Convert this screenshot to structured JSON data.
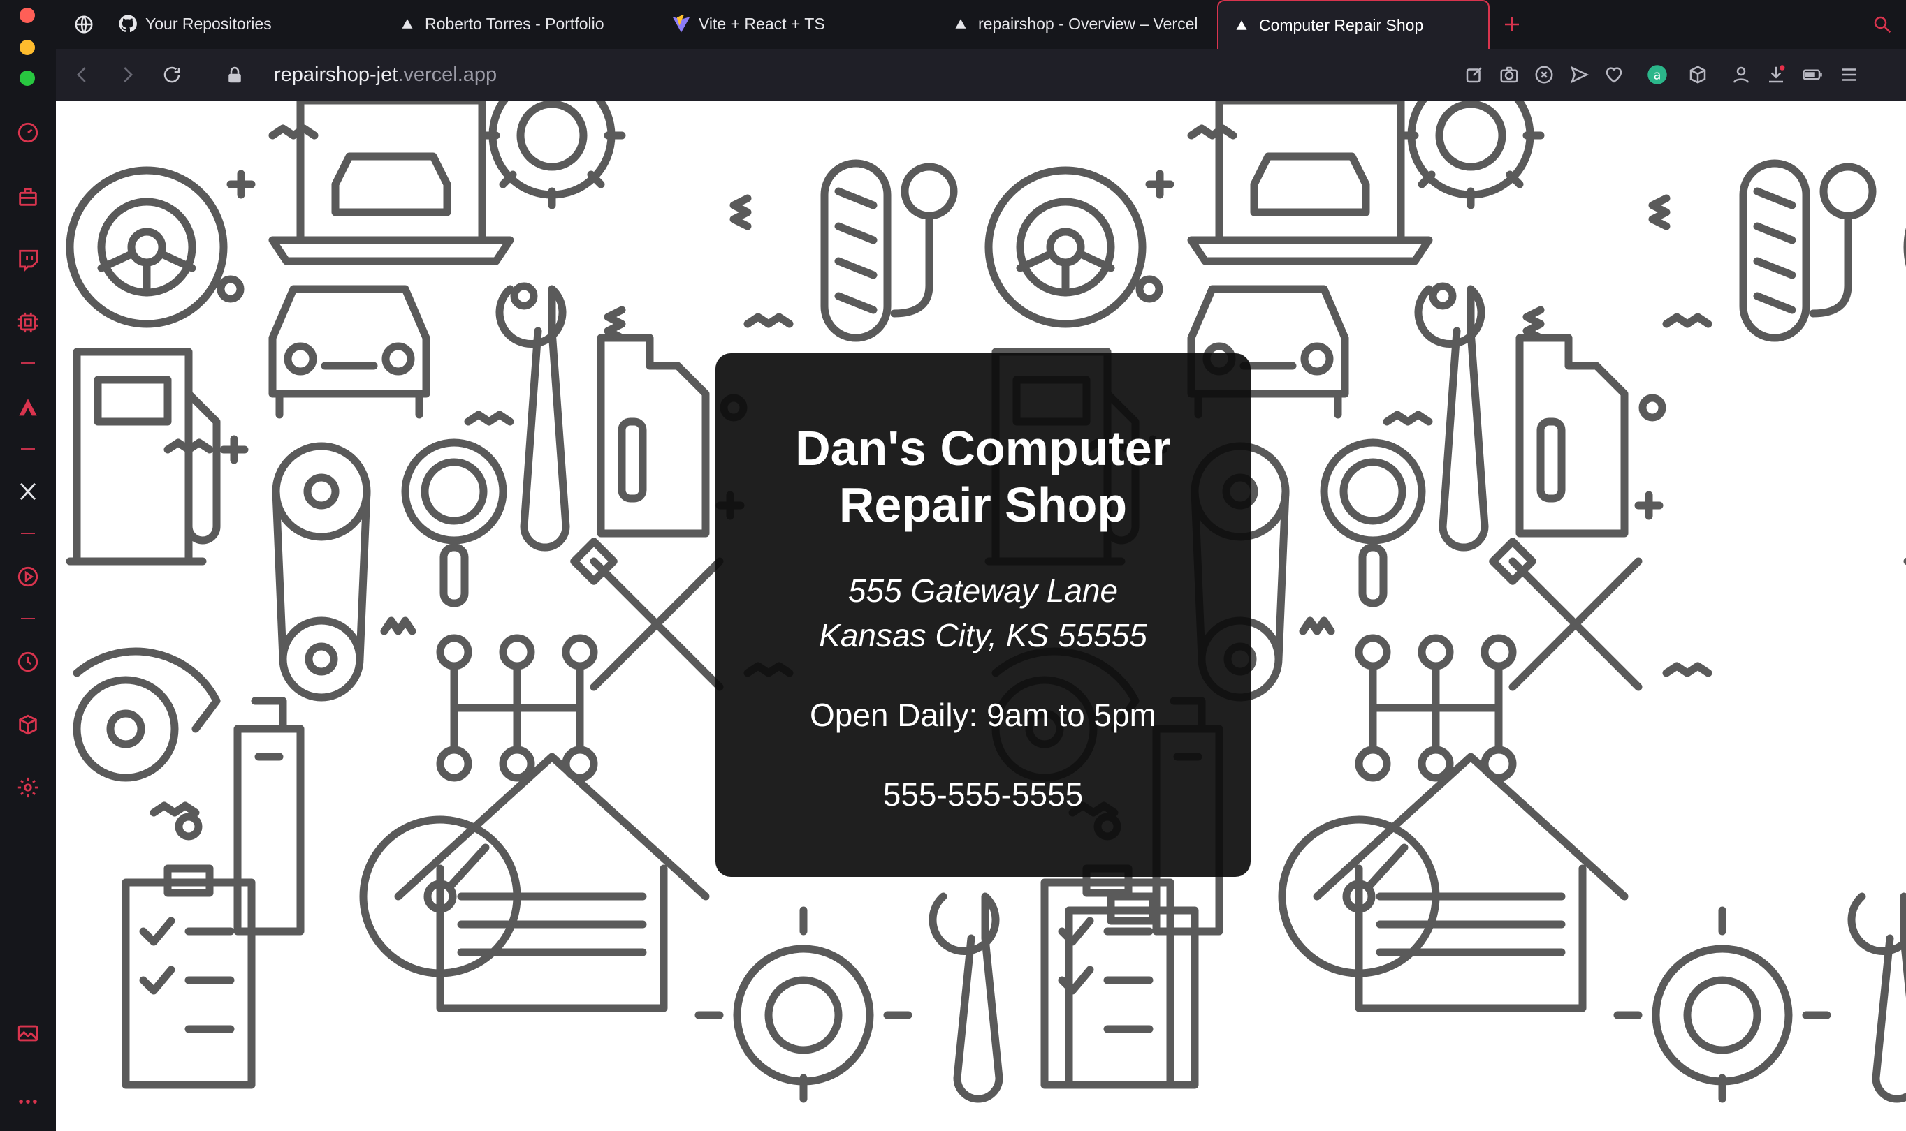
{
  "browser": {
    "tabs": [
      {
        "label": "Your Repositories",
        "icon": "github-icon",
        "active": false
      },
      {
        "label": "Roberto Torres - Portfolio",
        "icon": "vercel-triangle-icon",
        "active": false
      },
      {
        "label": "Vite + React + TS",
        "icon": "vite-icon",
        "active": false
      },
      {
        "label": "repairshop - Overview – Vercel",
        "icon": "vercel-triangle-icon",
        "active": false
      },
      {
        "label": "Computer Repair Shop",
        "icon": "vercel-triangle-icon",
        "active": true
      }
    ],
    "url": {
      "host": "repairshop-jet",
      "rest": ".vercel.app"
    },
    "accent_color": "#d9344e"
  },
  "sidebar": {
    "traffic_lights": [
      "#ff5f57",
      "#febc2e",
      "#28c840"
    ],
    "icons": [
      "speed-dial-icon",
      "workspaces-icon",
      "twitch-icon",
      "extensions-icon",
      "aria-icon",
      "x-twitter-icon",
      "player-icon",
      "history-icon",
      "box-icon",
      "settings-icon",
      "gallery-icon",
      "more-icon"
    ]
  },
  "page": {
    "title_line1": "Dan's Computer",
    "title_line2": "Repair Shop",
    "address_line1": "555 Gateway Lane",
    "address_line2": "Kansas City, KS 55555",
    "hours": "Open Daily: 9am to 5pm",
    "phone": "555-555-5555"
  }
}
